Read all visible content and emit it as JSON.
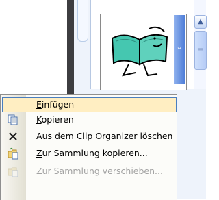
{
  "context_menu": {
    "items": [
      {
        "label": "Einfügen",
        "accel": "E",
        "rest": "infügen",
        "icon": "none",
        "state": "highlighted"
      },
      {
        "label": "Kopieren",
        "accel": "K",
        "rest": "opieren",
        "icon": "copy-icon",
        "state": "enabled"
      },
      {
        "label": "Aus dem Clip Organizer löschen",
        "accel": "A",
        "rest": "us dem Clip Organizer löschen",
        "icon": "delete-x-icon",
        "state": "enabled"
      },
      {
        "label": "Zur Sammlung kopieren...",
        "accel": "Z",
        "rest": "ur Sammlung kopieren...",
        "icon": "copy-to-collection-icon",
        "state": "enabled"
      },
      {
        "label": "Zur Sammlung verschieben...",
        "pre": "Zu",
        "accel": "r",
        "rest": " Sammlung verschieben...",
        "icon": "move-to-collection-icon",
        "state": "disabled"
      }
    ]
  },
  "gallery": {
    "thumbnail_icon": "reading-person-clip-art",
    "scroll_up_glyph": "▲",
    "scroll_thumb_glyph": "≡",
    "dropdown_glyph": "⌄"
  },
  "colors": {
    "highlight_fill": "#ffeec2",
    "highlight_border": "#4a7ebf",
    "disabled_text": "#a3a3a3"
  }
}
